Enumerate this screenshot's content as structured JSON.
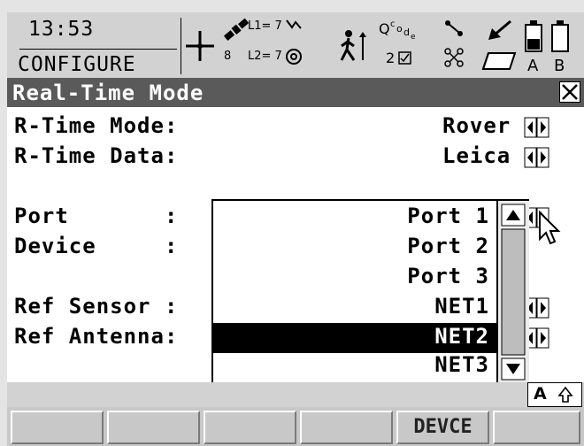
{
  "status": {
    "time": "13:53",
    "program": "CONFIGURE",
    "sat_l1": "L1= 7",
    "sat_l2": "L2= 7",
    "sat_count": "8",
    "rtk_count": "2"
  },
  "title": "Real-Time Mode",
  "fields": {
    "rtime_mode_label": "R-Time Mode:",
    "rtime_mode_value": "Rover",
    "rtime_data_label": "R-Time Data:",
    "rtime_data_value": "Leica",
    "port_label": "Port       :",
    "device_label": "Device     :",
    "ref_sensor_label": "Ref Sensor :",
    "ref_antenna_label": "Ref Antenna:"
  },
  "dropdown": {
    "options": [
      "Port 1",
      "Port 2",
      "Port 3",
      "NET1",
      "NET2",
      "NET3"
    ],
    "selected": "NET2"
  },
  "keyboard_indicator": "A",
  "function_keys": [
    "",
    "",
    "",
    "",
    "DEVCE",
    ""
  ],
  "colors": {
    "title_bg": "#5a5a5a",
    "status_bg": "#d2d2d2",
    "selection_bg": "#000000"
  }
}
